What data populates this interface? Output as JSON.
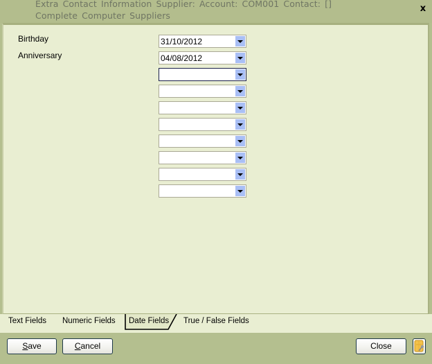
{
  "window": {
    "title": "Extra Contact Information Supplier: Account: COM001 Contact: [] Complete Computer Suppliers",
    "close_glyph": "x"
  },
  "fields": [
    {
      "label": "Birthday",
      "value": "31/10/2012"
    },
    {
      "label": "Anniversary",
      "value": "04/08/2012"
    },
    {
      "label": "",
      "value": ""
    },
    {
      "label": "",
      "value": ""
    },
    {
      "label": "",
      "value": ""
    },
    {
      "label": "",
      "value": ""
    },
    {
      "label": "",
      "value": ""
    },
    {
      "label": "",
      "value": ""
    },
    {
      "label": "",
      "value": ""
    },
    {
      "label": "",
      "value": ""
    }
  ],
  "tabs": [
    {
      "label": "Text Fields",
      "active": false
    },
    {
      "label": "Numeric Fields",
      "active": false
    },
    {
      "label": "Date Fields",
      "active": true
    },
    {
      "label": "True / False Fields",
      "active": false
    }
  ],
  "buttons": {
    "save_mnemonic": "S",
    "save_rest": "ave",
    "cancel_mnemonic": "C",
    "cancel_rest": "ancel",
    "close": "Close",
    "notes_icon": "notes-key-icon"
  },
  "colors": {
    "titlebar": "#b3bd8d",
    "panel": "#e9eed2",
    "dropdown_button": "#a9bff5"
  }
}
